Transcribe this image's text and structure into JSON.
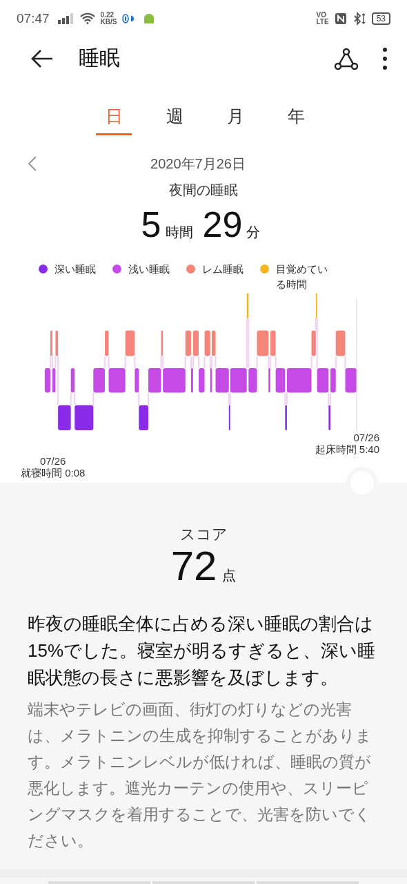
{
  "status_bar": {
    "time": "07:47",
    "net_speed": "0.22",
    "net_unit": "KB/S",
    "volte_top": "VO",
    "volte_bottom": "LTE",
    "battery": "53"
  },
  "header": {
    "title": "睡眠"
  },
  "tabs": [
    {
      "label": "日",
      "selected": true
    },
    {
      "label": "週",
      "selected": false
    },
    {
      "label": "月",
      "selected": false
    },
    {
      "label": "年",
      "selected": false
    }
  ],
  "date": "2020年7月26日",
  "summary": {
    "title": "夜間の睡眠",
    "hours": "5",
    "hours_unit": "時間",
    "minutes": "29",
    "minutes_unit": "分"
  },
  "legend": [
    {
      "label": "深い睡眠",
      "color": "#8a2be8"
    },
    {
      "label": "浅い睡眠",
      "color": "#c54ae6"
    },
    {
      "label": "レム睡眠",
      "color": "#f5847a"
    },
    {
      "label": "目覚めている時間",
      "color": "#f5b521"
    }
  ],
  "wake": {
    "date": "07/26",
    "label": "起床時間 5:40"
  },
  "bed": {
    "date": "07/26",
    "label": "就寝時間 0:08"
  },
  "score": {
    "title": "スコア",
    "value": "72",
    "unit": "点"
  },
  "advice": {
    "headline": "昨夜の睡眠全体に占める深い睡眠の割合は15%でした。寝室が明るすぎると、深い睡眠状態の長さに悪影響を及ぼします。",
    "body": "端末やテレビの画面、街灯の灯りなどの光害は、メラトニンの生成を抑制することがあります。メラトニンレベルが低ければ、睡眠の質が悪化します。遮光カーテンの使用や、スリーピングマスクを着用することで、光害を防いでください。"
  }
}
